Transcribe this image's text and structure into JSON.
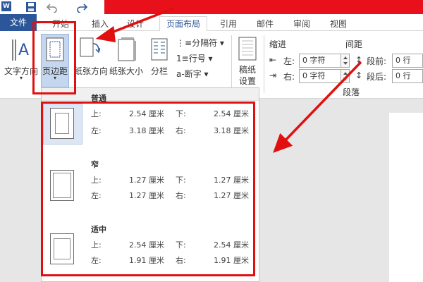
{
  "app": {
    "logo": "W",
    "tabs": [
      {
        "label": "文件"
      },
      {
        "label": "开始"
      },
      {
        "label": "插入"
      },
      {
        "label": "设计"
      },
      {
        "label": "页面布局"
      },
      {
        "label": "引用"
      },
      {
        "label": "邮件"
      },
      {
        "label": "审阅"
      },
      {
        "label": "视图"
      }
    ]
  },
  "ribbon": {
    "text_direction": "文字方向",
    "margins": "页边距",
    "orientation": "纸张方向",
    "size": "纸张大小",
    "columns": "分栏",
    "breaks": "分隔符",
    "line_numbers": "行号",
    "hyphenation": "断字",
    "manuscript_line1": "稿纸",
    "manuscript_line2": "设置",
    "indent_title": "缩进",
    "spacing_title": "间距",
    "indent_left_label": "左:",
    "indent_left_value": "0 字符",
    "indent_right_label": "右:",
    "indent_right_value": "0 字符",
    "spacing_before_label": "段前:",
    "spacing_before_value": "0 行",
    "spacing_after_label": "段后:",
    "spacing_after_value": "0 行",
    "paragraph_group": "段落"
  },
  "margins_menu": {
    "presets": [
      {
        "name": "普通",
        "top_label": "上:",
        "top": "2.54 厘米",
        "bottom_label": "下:",
        "bottom": "2.54 厘米",
        "left_label": "左:",
        "left": "3.18 厘米",
        "right_label": "右:",
        "right": "3.18 厘米"
      },
      {
        "name": "窄",
        "top_label": "上:",
        "top": "1.27 厘米",
        "bottom_label": "下:",
        "bottom": "1.27 厘米",
        "left_label": "左:",
        "left": "1.27 厘米",
        "right_label": "右:",
        "right": "1.27 厘米"
      },
      {
        "name": "适中",
        "top_label": "上:",
        "top": "2.54 厘米",
        "bottom_label": "下:",
        "bottom": "2.54 厘米",
        "left_label": "左:",
        "left": "1.91 厘米",
        "right_label": "右:",
        "right": "1.91 厘米"
      }
    ]
  },
  "colors": {
    "accent": "#2b579a",
    "annotation_red": "#e01010"
  }
}
